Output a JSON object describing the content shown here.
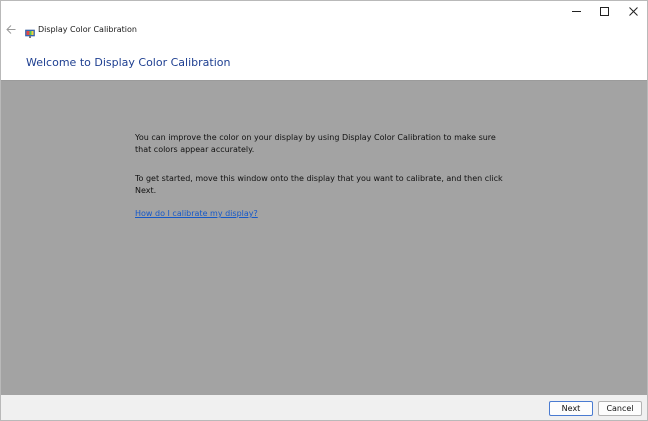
{
  "window": {
    "title": "Display Color Calibration",
    "back_icon": "back-arrow-icon",
    "app_icon": "display-calibration-icon"
  },
  "header": {
    "title": "Welcome to Display Color Calibration"
  },
  "content": {
    "paragraph1": "You can improve the color on your display by using Display Color Calibration to make sure that colors appear accurately.",
    "paragraph2": "To get started, move this window onto the display that you want to calibrate, and then click Next.",
    "help_link": "How do I calibrate my display?"
  },
  "footer": {
    "next_label": "Next",
    "cancel_label": "Cancel"
  },
  "colors": {
    "title_blue": "#1e3f91",
    "link_blue": "#1558c8",
    "content_bg": "#a3a3a3"
  }
}
